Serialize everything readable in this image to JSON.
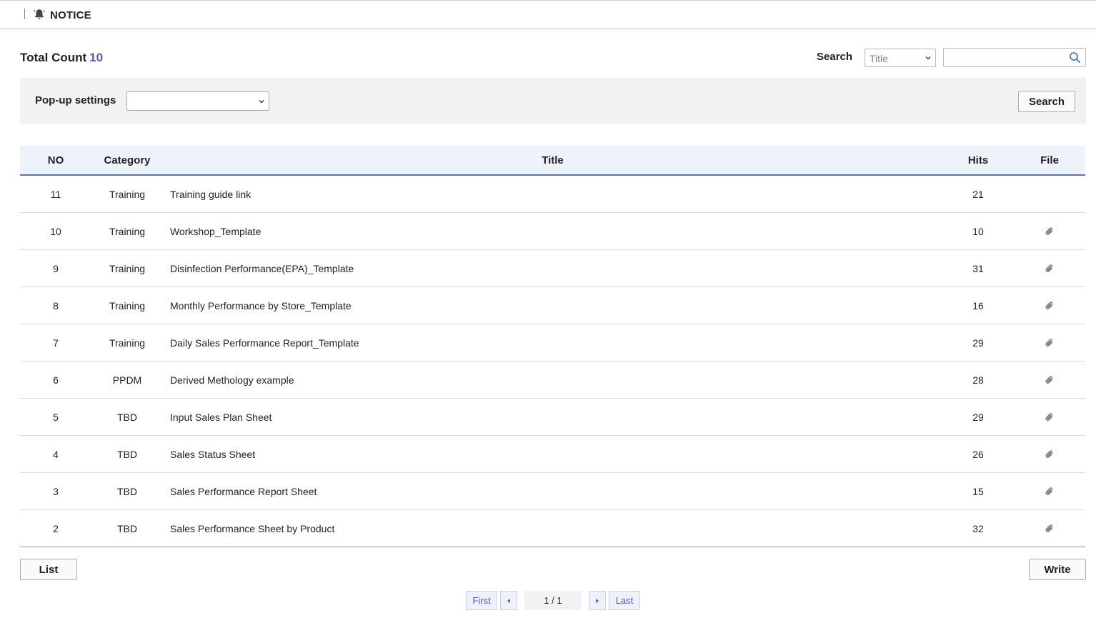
{
  "header": {
    "title": "NOTICE",
    "icon": "bell-icon"
  },
  "summary": {
    "total_label": "Total Count",
    "total_value": "10"
  },
  "search": {
    "label": "Search",
    "field_select": "Title",
    "input_value": "",
    "input_placeholder": ""
  },
  "filter": {
    "popup_label": "Pop-up settings",
    "popup_selected": "",
    "search_button": "Search"
  },
  "table": {
    "columns": {
      "no": "NO",
      "category": "Category",
      "title": "Title",
      "hits": "Hits",
      "file": "File"
    },
    "rows": [
      {
        "no": "11",
        "category": "Training",
        "title": "Training guide link",
        "hits": "21",
        "file": false
      },
      {
        "no": "10",
        "category": "Training",
        "title": "Workshop_Template",
        "hits": "10",
        "file": true
      },
      {
        "no": "9",
        "category": "Training",
        "title": "Disinfection Performance(EPA)_Template",
        "hits": "31",
        "file": true
      },
      {
        "no": "8",
        "category": "Training",
        "title": "Monthly Performance by Store_Template",
        "hits": "16",
        "file": true
      },
      {
        "no": "7",
        "category": "Training",
        "title": "Daily Sales Performance Report_Template",
        "hits": "29",
        "file": true
      },
      {
        "no": "6",
        "category": "PPDM",
        "title": "Derived Methology example",
        "hits": "28",
        "file": true
      },
      {
        "no": "5",
        "category": "TBD",
        "title": "Input Sales Plan Sheet",
        "hits": "29",
        "file": true
      },
      {
        "no": "4",
        "category": "TBD",
        "title": "Sales Status Sheet",
        "hits": "26",
        "file": true
      },
      {
        "no": "3",
        "category": "TBD",
        "title": "Sales Performance Report Sheet",
        "hits": "15",
        "file": true
      },
      {
        "no": "2",
        "category": "TBD",
        "title": "Sales Performance Sheet by Product",
        "hits": "32",
        "file": true
      }
    ]
  },
  "actions": {
    "list": "List",
    "write": "Write"
  },
  "pagination": {
    "first": "First",
    "last": "Last",
    "current": "1 / 1"
  },
  "colors": {
    "accent": "#4a5fc1",
    "header_bg": "#eef3fb",
    "header_border": "#5a78b0",
    "filter_bg": "#f2f2f5"
  }
}
